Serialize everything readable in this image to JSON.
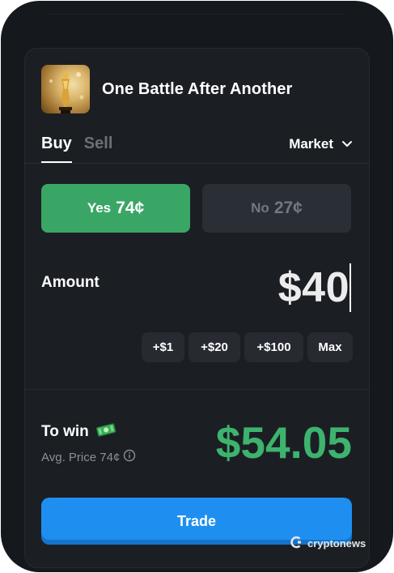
{
  "market": {
    "title": "One Battle After Another",
    "thumbnail_icon": "oscar-statuette-icon"
  },
  "tabs": [
    {
      "label": "Buy",
      "active": true
    },
    {
      "label": "Sell",
      "active": false
    }
  ],
  "order_type": {
    "selected": "Market",
    "icon": "chevron-down-icon"
  },
  "outcomes": {
    "yes": {
      "label": "Yes",
      "price": "74¢",
      "color": "#3aa666",
      "selected": true
    },
    "no": {
      "label": "No",
      "price": "27¢",
      "color": "#2a2e35",
      "selected": false
    }
  },
  "amount": {
    "label": "Amount",
    "value": "$40"
  },
  "quick_amounts": [
    "+$1",
    "+$20",
    "+$100",
    "Max"
  ],
  "summary": {
    "to_win_label": "To win",
    "to_win_icon": "money-icon",
    "avg_price_label": "Avg. Price 74¢",
    "info_icon": "info-icon",
    "payout": "$54.05",
    "payout_color": "#3db36e"
  },
  "trade_button": {
    "label": "Trade",
    "color": "#1e8ff0"
  },
  "watermark": {
    "text": "cryptonews"
  }
}
